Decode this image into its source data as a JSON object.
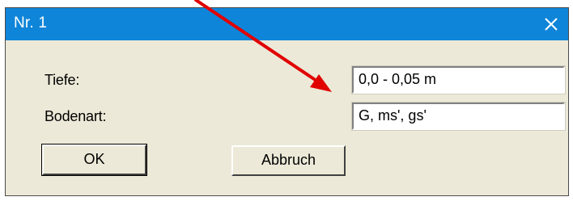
{
  "window": {
    "title": "Nr. 1"
  },
  "form": {
    "depth_label": "Tiefe:",
    "depth_value": "0,0 - 0,05 m",
    "soil_label": "Bodenart:",
    "soil_value": "G, ms', gs'"
  },
  "buttons": {
    "ok_label": "OK",
    "cancel_label": "Abbruch"
  },
  "colors": {
    "titlebar": "#0f85d9",
    "dialog_bg": "#ece9d8",
    "annotation_arrow": "#e00000"
  },
  "icons": {
    "close": "close-icon"
  }
}
